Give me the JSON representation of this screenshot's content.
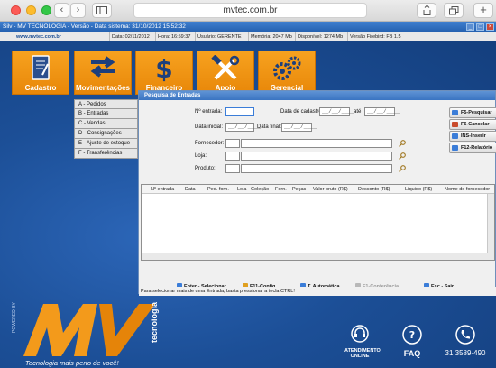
{
  "browser": {
    "url": "mvtec.com.br",
    "back": "‹",
    "forward": "›",
    "sidebar_icon": "sidebar-icon",
    "share_icon": "share-icon",
    "tabs_icon": "tabs-icon",
    "newtab": "+"
  },
  "app": {
    "title": "Silv - MV TECNOLOGIA - Versão  - Data sistema: 31/10/2012 15:52:32",
    "site": "www.mvtec.com.br",
    "info": {
      "data": "Data: 02/11/2012",
      "hora": "Hora: 16:59:37",
      "usuario": "Usuário: GERENTE",
      "memoria": "Memória: 2047 Mb",
      "disponivel": "Disponível: 1274 Mb",
      "versao": "Versão Firebird: FB 1.5"
    }
  },
  "tiles": [
    {
      "label": "Cadastro",
      "icon": "notebook-icon"
    },
    {
      "label": "Movimentações",
      "icon": "arrows-icon"
    },
    {
      "label": "Financeiro",
      "icon": "dollar-icon"
    },
    {
      "label": "Apoio",
      "icon": "tools-icon"
    },
    {
      "label": "Gerencial",
      "icon": "gears-icon"
    }
  ],
  "submenu": [
    "A - Pedidos",
    "B - Entradas",
    "C - Vendas",
    "D - Consignações",
    "E - Ajuste de estoque",
    "F - Transferências"
  ],
  "dialog": {
    "title": "Pesquisa de Entradas",
    "labels": {
      "n_entrada": "Nº entrada:",
      "data_cadastro": "Data de cadastro:",
      "ate": "até",
      "data_inicial": "Data inicial:",
      "data_final": "Data final:",
      "fornecedor": "Fornecedor:",
      "loja": "Loja:",
      "produto": "Produto:"
    },
    "date_placeholder": "__/__/____",
    "buttons": [
      {
        "label": "F5-Pesquisar",
        "color": "#3b7dd8"
      },
      {
        "label": "F6-Cancelar",
        "color": "#c94b2c"
      },
      {
        "label": "INS-Inserir",
        "color": "#3b7dd8"
      },
      {
        "label": "F12-Relatório",
        "color": "#3b7dd8"
      }
    ],
    "columns": [
      "Nº entrada",
      "Data",
      "Ped. forn.",
      "Loja",
      "Coleção",
      "Forn.",
      "Peças",
      "Valor bruto (R$)",
      "Desconto (R$)",
      "Líquido (R$)",
      "Nome do fornecedor"
    ],
    "fkeys": [
      "Enter - Selecionar",
      "F11-Config.",
      "T. Automática",
      "F1-Conferência",
      "Esc - Sair"
    ],
    "hint": "Para selecionar mais de uma Entrada, basta pressionar a tecla CTRL!"
  },
  "branding": {
    "slogan": "Tecnologia mais perto de você!",
    "powered": "POWERED BY",
    "tecnologia": "tecnologia",
    "atendimento": "ATENDIMENTO ONLINE",
    "faq": "FAQ",
    "phone": "31 3589-490"
  },
  "colors": {
    "orange": "#f39a1b",
    "blue": "#1a4d93"
  }
}
